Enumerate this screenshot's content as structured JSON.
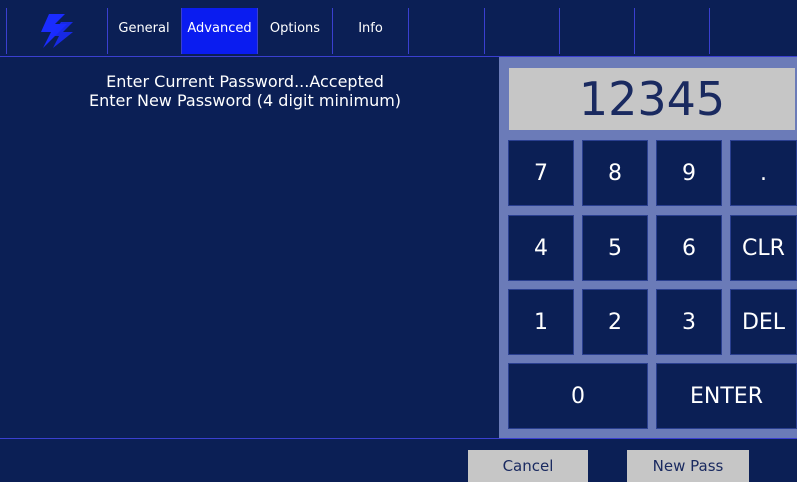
{
  "tabs": [
    "General",
    "Advanced",
    "Options",
    "Info"
  ],
  "active_tab": "Advanced",
  "message": {
    "line1": "Enter Current Password...Accepted",
    "line2": "Enter New Password (4 digit minimum)"
  },
  "display_value": "12345",
  "keys": {
    "k7": "7",
    "k8": "8",
    "k9": "9",
    "kdot": ".",
    "k4": "4",
    "k5": "5",
    "k6": "6",
    "kclr": "CLR",
    "k1": "1",
    "k2": "2",
    "k3": "3",
    "kdel": "DEL",
    "k0": "0",
    "kenter": "ENTER"
  },
  "buttons": {
    "cancel": "Cancel",
    "new_pass": "New Pass"
  },
  "colors": {
    "background": "#0b1f55",
    "active_tab": "#0a1cf0",
    "keypad_panel": "#6b7bb8",
    "display_bg": "#c6c6c6",
    "logo": "#1a2cff"
  }
}
